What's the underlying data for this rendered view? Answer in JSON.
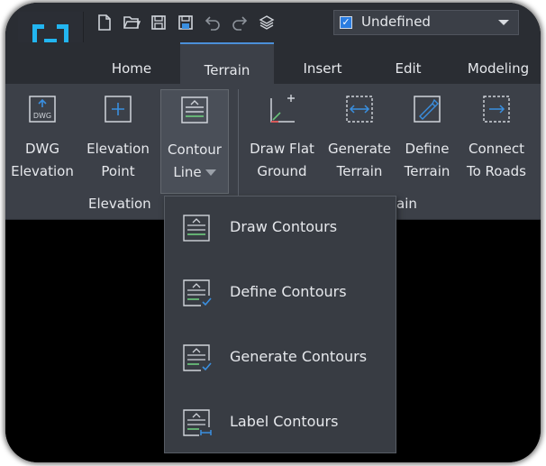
{
  "toolbar": {
    "app_logo": "app-logo-icon",
    "quick_access": [
      "new-file-icon",
      "open-folder-icon",
      "save-icon",
      "save-as-icon",
      "undo-icon",
      "redo-icon",
      "layers-icon"
    ],
    "layer_checked": true,
    "layer_value": "Undefined"
  },
  "tabs": [
    {
      "label": "Home",
      "active": false
    },
    {
      "label": "Terrain",
      "active": true
    },
    {
      "label": "Insert",
      "active": false
    },
    {
      "label": "Edit",
      "active": false
    },
    {
      "label": "Modeling",
      "active": false
    }
  ],
  "ribbon": {
    "groups": [
      {
        "label": "Elevation",
        "buttons": [
          {
            "line1": "DWG",
            "line2": "Elevation",
            "icon": "dwg-elevation-icon"
          },
          {
            "line1": "Elevation",
            "line2": "Point",
            "icon": "elevation-point-icon"
          },
          {
            "line1": "Contour",
            "line2": "Line",
            "icon": "contour-line-icon",
            "has_dropdown": true
          }
        ]
      },
      {
        "label": "ain",
        "buttons": [
          {
            "line1": "Draw Flat",
            "line2": "Ground",
            "icon": "draw-flat-ground-icon"
          },
          {
            "line1": "Generate",
            "line2": "Terrain",
            "icon": "generate-terrain-icon"
          },
          {
            "line1": "Define",
            "line2": "Terrain",
            "icon": "define-terrain-icon"
          },
          {
            "line1": "Connect",
            "line2": "To Roads",
            "icon": "connect-to-roads-icon"
          }
        ]
      }
    ]
  },
  "contour_menu": {
    "items": [
      {
        "label": "Draw Contours",
        "icon": "draw-contours-icon"
      },
      {
        "label": "Define Contours",
        "icon": "define-contours-icon"
      },
      {
        "label": "Generate Contours",
        "icon": "generate-contours-icon"
      },
      {
        "label": "Label Contours",
        "icon": "label-contours-icon"
      }
    ]
  },
  "colors": {
    "accent": "#2b7de1",
    "ribbon_bg": "#3c4048",
    "titlebar_bg": "#2a2d33",
    "icon_stroke": "#d0d4da",
    "icon_blue": "#3a8fe0",
    "icon_green": "#6ac27a",
    "canvas": "#000000"
  }
}
